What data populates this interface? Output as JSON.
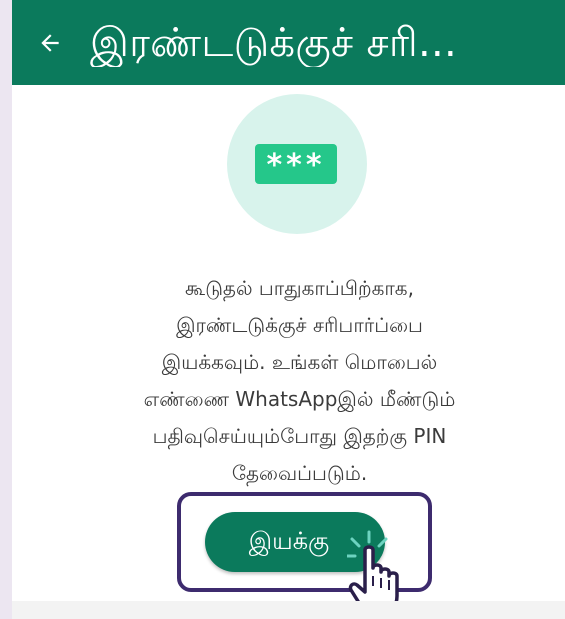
{
  "appbar": {
    "title": "இரண்டடுக்குச் சரி...",
    "back_icon": "arrow-left-icon",
    "background": "#0b7a5c"
  },
  "illustration": {
    "pin_text": "***",
    "circle_color": "#d8f3ec",
    "pin_color": "#25c78a"
  },
  "description": {
    "lines": [
      "கூடுதல் பாதுகாப்பிற்காக,",
      "இரண்டடுக்குச் சரிபார்ப்பை",
      "இயக்கவும். உங்கள் மொபைல்",
      "எண்ணை WhatsAppஇல் மீண்டும்",
      "பதிவுசெய்யும்போது இதற்கு PIN",
      "தேவைப்படும்."
    ]
  },
  "enable_button": {
    "label": "இயக்கு",
    "color": "#0b7a5c"
  },
  "annotation": {
    "highlight_color": "#3d2b6e",
    "pointer_icon": "hand-pointer-icon"
  }
}
